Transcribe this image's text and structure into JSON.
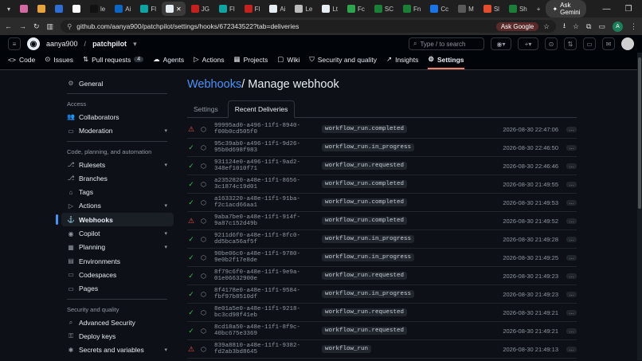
{
  "browser": {
    "tabs": [
      {
        "label": "",
        "color": "#d36aa3"
      },
      {
        "label": "",
        "color": "#e8a33b"
      },
      {
        "label": "",
        "color": "#2e6fd6"
      },
      {
        "label": "",
        "color": "#ffffff"
      },
      {
        "label": "le",
        "color": "#111111"
      },
      {
        "label": "Ai",
        "color": "#0a66c2"
      },
      {
        "label": "Fl",
        "color": "#0ea4a4"
      },
      {
        "label": "",
        "color": "#e6edf3"
      },
      {
        "label": "JG",
        "color": "#c5221f"
      },
      {
        "label": "Fl",
        "color": "#0ea4a4"
      },
      {
        "label": "Fl",
        "color": "#c5221f"
      },
      {
        "label": "Ai",
        "color": "#e6edf3"
      },
      {
        "label": "Le",
        "color": "#bbbbbb"
      },
      {
        "label": "Lt",
        "color": "#e6edf3"
      },
      {
        "label": "Fc",
        "color": "#2ea44f"
      },
      {
        "label": "SC",
        "color": "#1a7f37"
      },
      {
        "label": "Fn",
        "color": "#1a7f37"
      },
      {
        "label": "Cc",
        "color": "#1a73e8"
      },
      {
        "label": "M",
        "color": "#5a5a5a"
      },
      {
        "label": "Sl",
        "color": "#e44c2a"
      },
      {
        "label": "Sh",
        "color": "#1a7f37"
      }
    ],
    "gemini_label": "Ask Gemini",
    "url": "github.com/aanya900/patchpilot/settings/hooks/672343522?tab=deliveries",
    "ask_google": "Ask Google",
    "profile_letter": "A"
  },
  "header": {
    "owner": "aanya900",
    "repo": "patchpilot",
    "search_placeholder": "Type / to search"
  },
  "repo_nav": [
    {
      "icon": "<>",
      "label": "Code"
    },
    {
      "icon": "⊙",
      "label": "Issues"
    },
    {
      "icon": "⇅",
      "label": "Pull requests",
      "count": "4"
    },
    {
      "icon": "☁",
      "label": "Agents"
    },
    {
      "icon": "▷",
      "label": "Actions"
    },
    {
      "icon": "▦",
      "label": "Projects"
    },
    {
      "icon": "▢",
      "label": "Wiki"
    },
    {
      "icon": "⛉",
      "label": "Security and quality"
    },
    {
      "icon": "↗",
      "label": "Insights"
    },
    {
      "icon": "⚙",
      "label": "Settings",
      "active": true
    }
  ],
  "sidebar": {
    "general": "General",
    "access_heading": "Access",
    "access": [
      {
        "icon": "👥",
        "label": "Collaborators"
      },
      {
        "icon": "▭",
        "label": "Moderation",
        "expand": true
      }
    ],
    "code_heading": "Code, planning, and automation",
    "code": [
      {
        "icon": "⎇",
        "label": "Rulesets",
        "expand": true
      },
      {
        "icon": "⎇",
        "label": "Branches"
      },
      {
        "icon": "⌂",
        "label": "Tags"
      },
      {
        "icon": "▷",
        "label": "Actions",
        "expand": true
      },
      {
        "icon": "⚓",
        "label": "Webhooks",
        "active": true
      },
      {
        "icon": "◉",
        "label": "Copilot",
        "expand": true
      },
      {
        "icon": "▦",
        "label": "Planning",
        "expand": true
      },
      {
        "icon": "▤",
        "label": "Environments"
      },
      {
        "icon": "▭",
        "label": "Codespaces"
      },
      {
        "icon": "▭",
        "label": "Pages"
      }
    ],
    "security_heading": "Security and quality",
    "security": [
      {
        "icon": "⌕",
        "label": "Advanced Security"
      },
      {
        "icon": "⚿",
        "label": "Deploy keys"
      },
      {
        "icon": "✱",
        "label": "Secrets and variables",
        "expand": true
      }
    ]
  },
  "content": {
    "title_link": "Webhooks",
    "title_rest": " / Manage webhook",
    "tabs": [
      "Settings",
      "Recent Deliveries"
    ],
    "deliveries": [
      {
        "status": "warn",
        "guid": "99995ad0-a496-11f1-8940-f00b0cd505f0",
        "event": "workflow_run.completed",
        "time": "2026-08-30 22:47:06"
      },
      {
        "status": "ok",
        "guid": "95c39ab0-a496-11f1-9d26-95b0d698f983",
        "event": "workflow_run.in_progress",
        "time": "2026-08-30 22:46:50"
      },
      {
        "status": "ok",
        "guid": "931124e0-a496-11f1-9ad2-348ef1010f71",
        "event": "workflow_run.requested",
        "time": "2026-08-30 22:46:46"
      },
      {
        "status": "ok",
        "guid": "a2352820-a48e-11f1-8656-3c1874c19d01",
        "event": "workflow_run.completed",
        "time": "2026-08-30 21:49:55"
      },
      {
        "status": "ok",
        "guid": "a1633220-a48e-11f1-91ba-f2c1acd66aa1",
        "event": "workflow_run.completed",
        "time": "2026-08-30 21:49:53"
      },
      {
        "status": "warn",
        "guid": "9aba7be0-a48e-11f1-914f-9a87c152d49b",
        "event": "workflow_run.completed",
        "time": "2026-08-30 21:49:52"
      },
      {
        "status": "ok",
        "guid": "9211d6f0-a48e-11f1-8fc0-dd5bca56af5f",
        "event": "workflow_run.in_progress",
        "time": "2026-08-30 21:49:28"
      },
      {
        "status": "ok",
        "guid": "90be06c0-a48e-11f1-9780-9e0b2f17e8de",
        "event": "workflow_run.in_progress",
        "time": "2026-08-30 21:49:25"
      },
      {
        "status": "ok",
        "guid": "8f79c6f0-a48e-11f1-9e9a-01e06632900e",
        "event": "workflow_run.requested",
        "time": "2026-08-30 21:49:23"
      },
      {
        "status": "ok",
        "guid": "8f4178e0-a48e-11f1-9584-fbf97b8510df",
        "event": "workflow_run.in_progress",
        "time": "2026-08-30 21:49:23"
      },
      {
        "status": "ok",
        "guid": "8e01a5e0-a48e-11f1-9218-bc3cd98f41eb",
        "event": "workflow_run.requested",
        "time": "2026-08-30 21:49:21"
      },
      {
        "status": "ok",
        "guid": "8cd18a50-a48e-11f1-8f9c-40bc675e3369",
        "event": "workflow_run.requested",
        "time": "2026-08-30 21:49:21"
      },
      {
        "status": "warn",
        "guid": "839a8810-a48e-11f1-9382-fd2ab3bd8645",
        "event": "workflow_run",
        "time": "2026-08-30 21:49:13"
      }
    ],
    "more_label": "…"
  }
}
